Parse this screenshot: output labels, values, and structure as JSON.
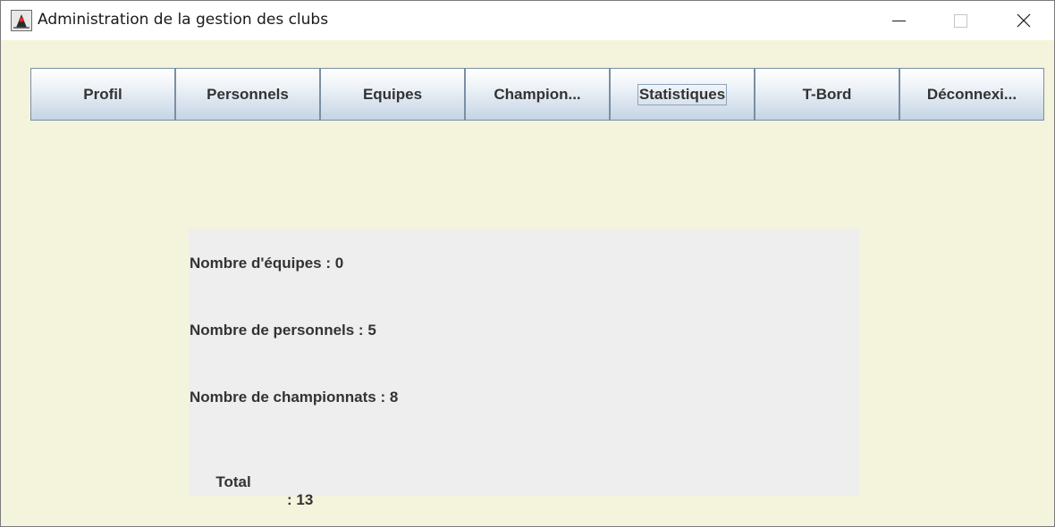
{
  "window": {
    "title": "Administration de la gestion des clubs",
    "icon": "java-duke-icon",
    "controls": [
      "minimize-icon",
      "maximize-icon",
      "close-icon"
    ]
  },
  "tabs": [
    {
      "label": "Profil",
      "focused": false
    },
    {
      "label": "Personnels",
      "focused": false
    },
    {
      "label": "Equipes",
      "focused": false
    },
    {
      "label": "Champion...",
      "focused": false
    },
    {
      "label": "Statistiques",
      "focused": true
    },
    {
      "label": "T-Bord",
      "focused": false
    },
    {
      "label": "Déconnexi...",
      "focused": false
    }
  ],
  "stats": {
    "equipes": "Nombre d'équipes : 0",
    "personnels": "Nombre de personnels : 5",
    "championnats": "Nombre de championnats : 8",
    "total_label": "Total",
    "total_value": ": 13"
  },
  "colors": {
    "background": "#f4f4dc",
    "panel": "#eeeeee",
    "tab_border": "#7b8ea3",
    "text": "#333333"
  }
}
